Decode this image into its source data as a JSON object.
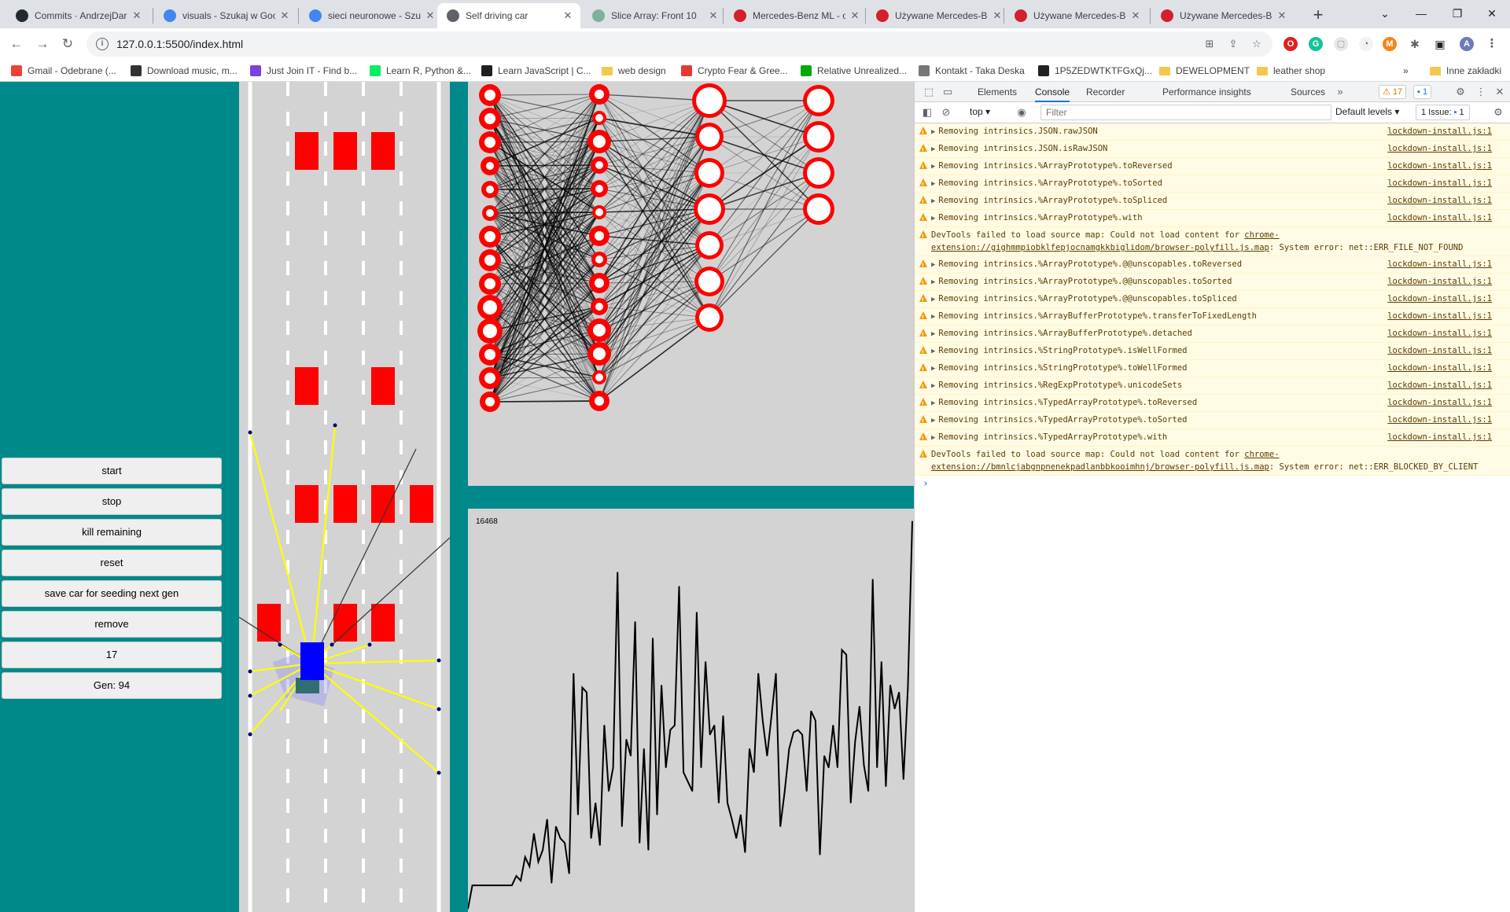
{
  "tabs": [
    {
      "title": "Commits · AndrzejDar",
      "icon": "github-icon",
      "color": "#24292f"
    },
    {
      "title": "visuals - Szukaj w Goo",
      "icon": "google-icon",
      "color": "#4285f4"
    },
    {
      "title": "sieci neuronowe - Szu",
      "icon": "google-icon",
      "color": "#4285f4"
    },
    {
      "title": "Self driving car",
      "icon": "globe-icon",
      "color": "#5f6368",
      "active": true
    },
    {
      "title": "Slice Array: Front 10",
      "icon": "page-icon",
      "color": "#7ab39a"
    },
    {
      "title": "Mercedes-Benz ML - o",
      "icon": "otomoto-icon",
      "color": "#d41f2c"
    },
    {
      "title": "Używane Mercedes-Be",
      "icon": "otomoto-icon",
      "color": "#d41f2c"
    },
    {
      "title": "Używane Mercedes-Be",
      "icon": "otomoto-icon",
      "color": "#d41f2c"
    },
    {
      "title": "Używane Mercedes-Be",
      "icon": "otomoto-icon",
      "color": "#d41f2c"
    }
  ],
  "address": {
    "url": "127.0.0.1:5500/index.html"
  },
  "bookmarks": [
    {
      "label": "Gmail - Odebrane (...",
      "icon": "gmail-icon",
      "color": "#ea4335"
    },
    {
      "label": "Download music, m...",
      "icon": "car-icon",
      "color": "#333"
    },
    {
      "label": "Just Join IT - Find b...",
      "icon": "justjoin-icon",
      "color": "#7b3fe4"
    },
    {
      "label": "Learn R, Python &...",
      "icon": "datacamp-icon",
      "color": "#03ef62"
    },
    {
      "label": "Learn JavaScript | C...",
      "icon": "codecademy-icon",
      "color": "#1f1f1f"
    },
    {
      "label": "web design",
      "icon": "folder-icon",
      "color": "#f2c94c"
    },
    {
      "label": "Crypto Fear & Gree...",
      "icon": "alternative-icon",
      "color": "#e53935"
    },
    {
      "label": "Relative Unrealized...",
      "icon": "bookmark-b-icon",
      "color": "#0a0"
    },
    {
      "label": "Kontakt - Taka Deska",
      "icon": "page-icon",
      "color": "#777"
    },
    {
      "label": "1P5ZEDWTKTFGxQj...",
      "icon": "bitcoin-icon",
      "color": "#222"
    },
    {
      "label": "DEWELOPMENT",
      "icon": "folder-icon",
      "color": "#f2c94c"
    },
    {
      "label": "leather shop",
      "icon": "folder-icon",
      "color": "#f2c94c"
    }
  ],
  "bookmarks_other": "Inne zakładki",
  "controls": {
    "start": "start",
    "stop": "stop",
    "kill": "kill remaining",
    "reset": "reset",
    "save": "save car for seeding next gen",
    "remove": "remove",
    "count": "17",
    "gen": "Gen: 94"
  },
  "graph": {
    "max_label": "16468"
  },
  "chart_data": {
    "type": "line",
    "title": "",
    "xlabel": "",
    "ylabel": "",
    "ylim": [
      0,
      16468
    ],
    "series": [
      {
        "values": [
          0,
          1000,
          1000,
          1000,
          1000,
          1000,
          1000,
          1000,
          1000,
          1000,
          1000,
          1400,
          1200,
          2200,
          1800,
          3200,
          2000,
          2500,
          3800,
          1100,
          3500,
          3000,
          2800,
          1500,
          10000,
          4000,
          9400,
          9200,
          3000,
          4500,
          2700,
          7800,
          5000,
          6000,
          14300,
          3500,
          7200,
          6500,
          12200,
          2800,
          6800,
          2500,
          11500,
          4000,
          9500,
          6000,
          7600,
          7800,
          13700,
          5800,
          5400,
          5000,
          12600,
          6000,
          10500,
          7400,
          7800,
          4500,
          8200,
          4500,
          3800,
          3000,
          4000,
          2400,
          6800,
          5800,
          10000,
          8000,
          6500,
          8200,
          10000,
          3500,
          5000,
          6800,
          7500,
          7600,
          7400,
          5000,
          8400,
          8000,
          2300,
          6500,
          6000,
          7800,
          6000,
          11000,
          10800,
          4500,
          7100,
          8600,
          6100,
          5000,
          14000,
          6000,
          10500,
          5200,
          9500,
          8500,
          9200,
          5500,
          9400,
          16468
        ]
      }
    ]
  },
  "devtools": {
    "tabs": [
      "Elements",
      "Console",
      "Recorder",
      "Performance insights",
      "Sources"
    ],
    "warnings_count": "17",
    "messages_count": "1",
    "context": "top",
    "filter_placeholder": "Filter",
    "levels": "Default levels",
    "issues": "1 Issue: ",
    "issues_count": "1",
    "console": [
      {
        "text": "Removing intrinsics.JSON.rawJSON",
        "src": "lockdown-install.js:1",
        "expand": true
      },
      {
        "text": "Removing intrinsics.JSON.isRawJSON",
        "src": "lockdown-install.js:1",
        "expand": true
      },
      {
        "text": "Removing intrinsics.%ArrayPrototype%.toReversed",
        "src": "lockdown-install.js:1",
        "expand": true
      },
      {
        "text": "Removing intrinsics.%ArrayPrototype%.toSorted",
        "src": "lockdown-install.js:1",
        "expand": true
      },
      {
        "text": "Removing intrinsics.%ArrayPrototype%.toSpliced",
        "src": "lockdown-install.js:1",
        "expand": true
      },
      {
        "text": "Removing intrinsics.%ArrayPrototype%.with",
        "src": "lockdown-install.js:1",
        "expand": true
      },
      {
        "text": "DevTools failed to load source map: Could not load content for ",
        "link": "chrome-extension://gighmmpiobklfepjocnamgkkbiglidom/browser-polyfill.js.map",
        "tail": ": System error: net::ERR_FILE_NOT_FOUND",
        "src": "",
        "expand": false
      },
      {
        "text": "Removing intrinsics.%ArrayPrototype%.@@unscopables.toReversed",
        "src": "lockdown-install.js:1",
        "expand": true
      },
      {
        "text": "Removing intrinsics.%ArrayPrototype%.@@unscopables.toSorted",
        "src": "lockdown-install.js:1",
        "expand": true
      },
      {
        "text": "Removing intrinsics.%ArrayPrototype%.@@unscopables.toSpliced",
        "src": "lockdown-install.js:1",
        "expand": true
      },
      {
        "text": "Removing intrinsics.%ArrayBufferPrototype%.transferToFixedLength",
        "src": "lockdown-install.js:1",
        "expand": true
      },
      {
        "text": "Removing intrinsics.%ArrayBufferPrototype%.detached",
        "src": "lockdown-install.js:1",
        "expand": true
      },
      {
        "text": "Removing intrinsics.%StringPrototype%.isWellFormed",
        "src": "lockdown-install.js:1",
        "expand": true
      },
      {
        "text": "Removing intrinsics.%StringPrototype%.toWellFormed",
        "src": "lockdown-install.js:1",
        "expand": true
      },
      {
        "text": "Removing intrinsics.%RegExpPrototype%.unicodeSets",
        "src": "lockdown-install.js:1",
        "expand": true
      },
      {
        "text": "Removing intrinsics.%TypedArrayPrototype%.toReversed",
        "src": "lockdown-install.js:1",
        "expand": true
      },
      {
        "text": "Removing intrinsics.%TypedArrayPrototype%.toSorted",
        "src": "lockdown-install.js:1",
        "expand": true
      },
      {
        "text": "Removing intrinsics.%TypedArrayPrototype%.with",
        "src": "lockdown-install.js:1",
        "expand": true
      },
      {
        "text": "DevTools failed to load source map: Could not load content for ",
        "link": "chrome-extension://bmnlcjabgnpnenekpadlanbbkooimhnj/browser-polyfill.js.map",
        "tail": ": System error: net::ERR_BLOCKED_BY_CLIENT",
        "src": "",
        "expand": false
      }
    ]
  },
  "colors": {
    "page_bg": "#00898a",
    "canvas_bg": "#d3d3d3",
    "traffic": "#ff0000",
    "player": "#0000ff",
    "sensor": "#ffff00",
    "neuron": "#ff0000"
  }
}
